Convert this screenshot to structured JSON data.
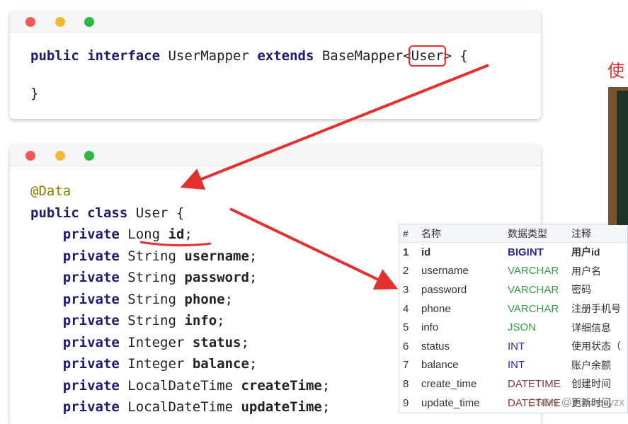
{
  "window1": {
    "lines": [
      [
        "public interface",
        " UserMapper ",
        "extends",
        " BaseMapper<",
        "User",
        "> {"
      ],
      [
        "}"
      ]
    ]
  },
  "window2": {
    "annotation": "@Data",
    "class_line": {
      "kw": "public class",
      "rest": " User {"
    },
    "fields": [
      {
        "type": "Long",
        "name": "id"
      },
      {
        "type": "String",
        "name": "username"
      },
      {
        "type": "String",
        "name": "password"
      },
      {
        "type": "String",
        "name": "phone"
      },
      {
        "type": "String",
        "name": "info"
      },
      {
        "type": "Integer",
        "name": "status"
      },
      {
        "type": "Integer",
        "name": "balance"
      },
      {
        "type": "LocalDateTime",
        "name": "createTime"
      },
      {
        "type": "LocalDateTime",
        "name": "updateTime"
      }
    ],
    "private_kw": "private"
  },
  "table": {
    "headers": [
      "#",
      "名称",
      "数据类型",
      "注释"
    ],
    "rows": [
      [
        "1",
        "id",
        "BIGINT",
        "用户id"
      ],
      [
        "2",
        "username",
        "VARCHAR",
        "用户名"
      ],
      [
        "3",
        "password",
        "VARCHAR",
        "密码"
      ],
      [
        "4",
        "phone",
        "VARCHAR",
        "注册手机号"
      ],
      [
        "5",
        "info",
        "JSON",
        "详细信息"
      ],
      [
        "6",
        "status",
        "INT",
        "使用状态（"
      ],
      [
        "7",
        "balance",
        "INT",
        "账户余额"
      ],
      [
        "8",
        "create_time",
        "DATETIME",
        "创建时间"
      ],
      [
        "9",
        "update_time",
        "DATETIME",
        "更新时间"
      ]
    ],
    "type_colors": {
      "BIGINT": "#2c2c8c",
      "VARCHAR": "#3a9a4a",
      "JSON": "#3a9a4a",
      "INT": "#2c2c8c",
      "DATETIME": "#8a3a3a"
    }
  },
  "side_text": "使",
  "watermark": "CSDN @Future_yzx",
  "colors": {
    "arrow": "#e53030"
  }
}
